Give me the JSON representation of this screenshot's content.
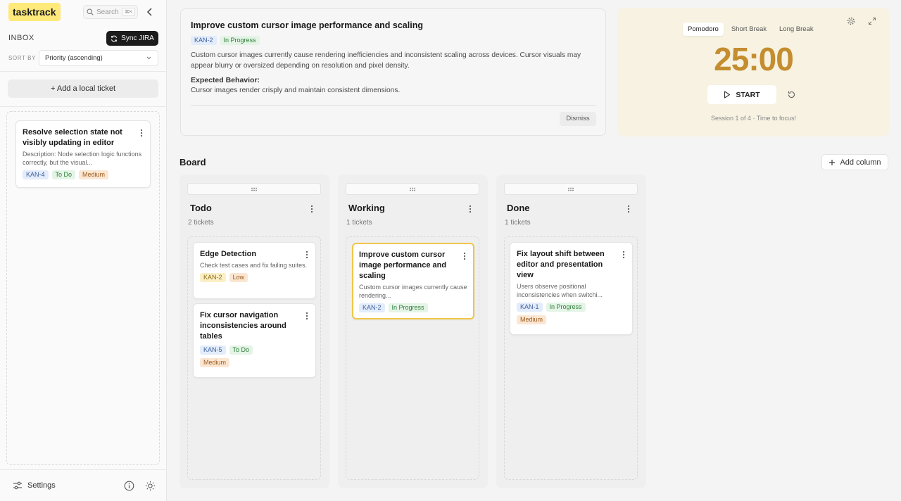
{
  "app": {
    "logo": "tasktrack"
  },
  "search": {
    "label": "Search",
    "shortcut": "⌘K"
  },
  "sidebar": {
    "inbox_title": "INBOX",
    "sync_label": "Sync JIRA",
    "sort_label": "SORT BY",
    "sort_value": "Priority (ascending)",
    "add_local_label": "+ Add a local ticket",
    "inbox_cards": [
      {
        "title": "Resolve selection state not visibly updating in editor",
        "desc": "Description: Node selection logic functions correctly, but the visual...",
        "key": "KAN-4",
        "status": "To Do",
        "priority": "Medium"
      }
    ],
    "settings_label": "Settings"
  },
  "detail": {
    "title": "Improve custom cursor image performance and scaling",
    "key": "KAN-2",
    "status": "In Progress",
    "description": "Custom cursor images currently cause rendering inefficiencies and inconsistent scaling across devices. Cursor visuals may appear blurry or oversized depending on resolution and pixel density.",
    "expected_label": "Expected Behavior:",
    "expected_value": "Cursor images render crisply and maintain consistent dimensions.",
    "dismiss_label": "Dismiss"
  },
  "pomodoro": {
    "modes": [
      "Pomodoro",
      "Short Break",
      "Long Break"
    ],
    "selected_mode": "Pomodoro",
    "time": "25:00",
    "start_label": "START",
    "session_text": "Session 1 of 4  ·  Time to focus!",
    "accent_color": "#c48d2f"
  },
  "board": {
    "title": "Board",
    "add_column_label": "Add column",
    "columns": [
      {
        "name": "Todo",
        "count": "2 tickets",
        "cards": [
          {
            "title": "Edge Detection",
            "desc": "Check test cases and fix failing suites.",
            "key": "KAN-2",
            "priority": "Low"
          },
          {
            "title": "Fix cursor navigation inconsistencies around tables",
            "key": "KAN-5",
            "status": "To Do",
            "priority": "Medium"
          }
        ]
      },
      {
        "name": "Working",
        "count": "1 tickets",
        "cards": [
          {
            "title": "Improve custom cursor image performance and scaling",
            "desc": "Custom cursor images currently cause rendering...",
            "key": "KAN-2",
            "status": "In Progress"
          }
        ]
      },
      {
        "name": "Done",
        "count": "1 tickets",
        "cards": [
          {
            "title": "Fix layout shift between editor and presentation view",
            "desc": "Users observe positional inconsistencies when switchi...",
            "key": "KAN-1",
            "status": "In Progress",
            "priority": "Medium"
          }
        ]
      }
    ]
  }
}
